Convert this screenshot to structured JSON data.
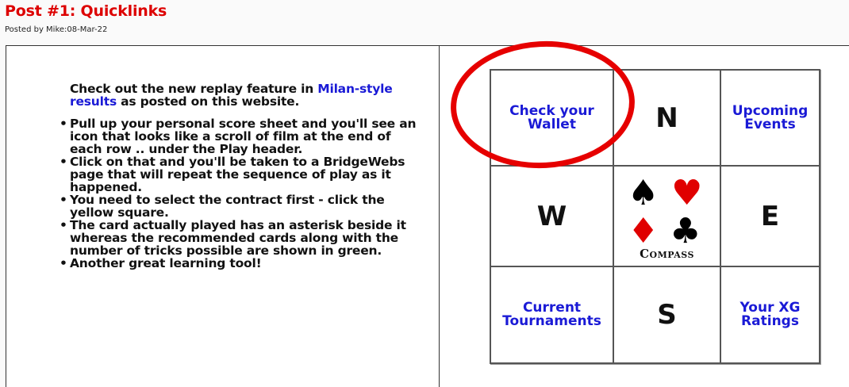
{
  "post": {
    "title": "Post #1: Quicklinks",
    "meta": "Posted by Mike:08-Mar-22"
  },
  "article": {
    "intro_prefix": "Check out the new replay feature in ",
    "intro_link": "Milan-style results",
    "intro_suffix": " as posted on this website.",
    "bullets": [
      "Pull up your personal score sheet and you'll see an icon that looks like a scroll of film at the end of each row .. under the Play header.",
      "Click on that and you'll be taken to a BridgeWebs page that will repeat the sequence of play as it happened.",
      "You need to select the contract first - click the yellow square.",
      "The card actually played has an asterisk beside it whereas the recommended cards along with the number of tricks possible are shown in green.",
      "Another great learning tool!"
    ]
  },
  "quicklinks": {
    "wallet": "Check your Wallet",
    "north": "N",
    "events": "Upcoming Events",
    "west": "W",
    "east": "E",
    "tournaments": "Current Tournaments",
    "south": "S",
    "ratings": "Your XG Ratings",
    "compass_word": "Compass",
    "suits": {
      "spade": "♠",
      "heart": "♥",
      "diamond": "♦",
      "club": "♣"
    }
  },
  "colors": {
    "title": "#dd0000",
    "link": "#1a1ad6",
    "highlight_circle": "#e60000"
  }
}
